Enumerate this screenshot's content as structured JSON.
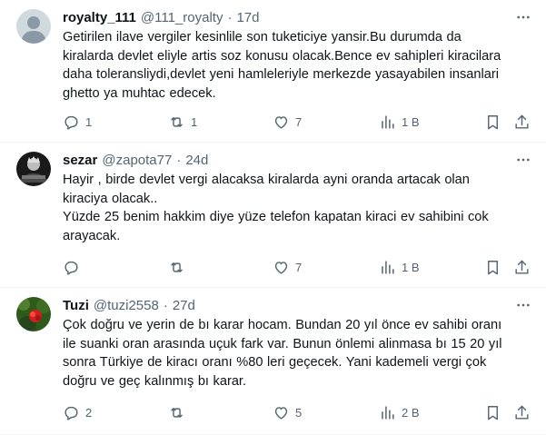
{
  "tweets": [
    {
      "name": "royalty_111",
      "handle": "@111_royalty",
      "separator": "·",
      "time": "17d",
      "text": "Getirilen ilave vergiler kesinlile son tuketiciye yansir.Bu durumda da\nkiralarda devlet eliyle artis soz konusu olacak.Bence ev sahipleri kiracilara\ndaha toleransliydi,devlet yeni hamleleriyle merkezde yasayabilen insanlari\nghetto ya muhtac edecek.",
      "replies": "1",
      "retweets": "1",
      "likes": "7",
      "views": "1 B"
    },
    {
      "name": "sezar",
      "handle": "@zapota77",
      "separator": "·",
      "time": "24d",
      "text": "Hayir , birde devlet vergi alacaksa kiralarda ayni oranda artacak olan\nkiraciya olacak..\nYüzde 25 benim hakkim diye yüze telefon kapatan kiraci ev sahibini cok\narayacak.",
      "replies": "",
      "retweets": "",
      "likes": "7",
      "views": "1 B"
    },
    {
      "name": "Tuzi",
      "handle": "@tuzi2558",
      "separator": "·",
      "time": "27d",
      "text": "Çok doğru ve yerin de bı karar hocam. Bundan 20 yıl önce ev sahibi oranı\nile suanki oran arasında uçuk fark var. Bunun önlemi alinmasa bı 15 20 yıl\nsonra Türkiye de kiracı oranı %80 leri geçecek. Yani kademeli vergi çok\ndoğru ve geç kalınmış bı karar.",
      "replies": "2",
      "retweets": "",
      "likes": "5",
      "views": "2 B"
    }
  ],
  "icons": {
    "more": "more-horizontal-icon",
    "reply": "reply-icon",
    "retweet": "retweet-icon",
    "like": "heart-icon",
    "views": "views-chart-icon",
    "bookmark": "bookmark-icon",
    "share": "share-icon"
  },
  "colors": {
    "text": "#0f1419",
    "secondary": "#536471",
    "divider": "#eff3f4"
  }
}
